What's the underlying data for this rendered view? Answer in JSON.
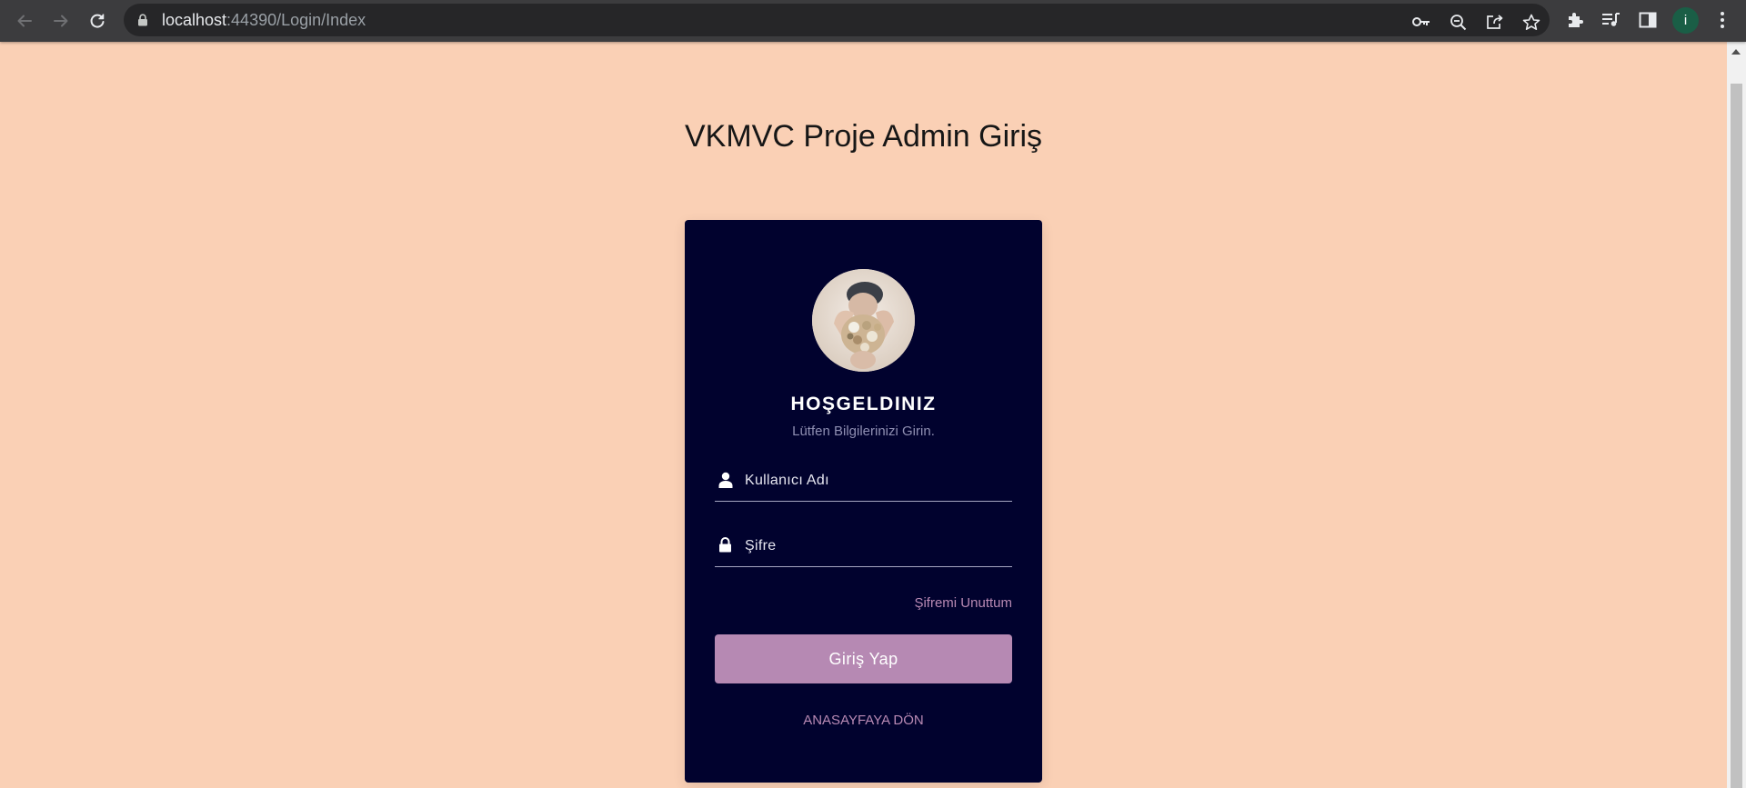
{
  "browser": {
    "url_host": "localhost",
    "url_rest": ":44390/Login/Index",
    "profile_initial": "i",
    "icons": [
      "back-arrow-icon",
      "forward-arrow-icon",
      "reload-icon",
      "lock-icon",
      "key-icon",
      "zoom-out-icon",
      "share-icon",
      "star-icon",
      "puzzle-icon",
      "media-queue-icon",
      "side-panel-icon",
      "kebab-menu-icon"
    ]
  },
  "page": {
    "title": "VKMVC Proje Admin Giriş",
    "background_color": "#fad0b5"
  },
  "login": {
    "welcome": "HOŞGELDINIZ",
    "subtitle": "Lütfen Bilgilerinizi Girin.",
    "username_placeholder": "Kullanıcı Adı",
    "password_placeholder": "Şifre",
    "forgot_password": "Şifremi Unuttum",
    "submit": "Giriş Yap",
    "home_link": "ANASAYFAYA DÖN",
    "card_color": "#01022e",
    "button_color": "#b689b3",
    "link_color": "#b98ab4"
  }
}
